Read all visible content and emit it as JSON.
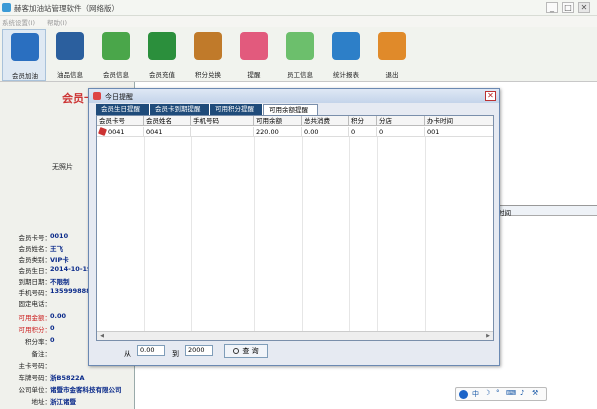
{
  "window": {
    "title": "赫客加油站管理软件（网络版）",
    "minimize": "_",
    "maximize": "□",
    "close": "✕"
  },
  "menu": [
    "系统设置(I)",
    "帮助(I)"
  ],
  "toolbar": [
    {
      "label": "会员加油",
      "icon": "member-fuel-icon",
      "color": "#2a6fc0"
    },
    {
      "label": "油品信息",
      "icon": "oil-info-icon",
      "color": "#2b5f9e"
    },
    {
      "label": "会员信息",
      "icon": "member-info-icon",
      "color": "#4aa64a"
    },
    {
      "label": "会员充值",
      "icon": "recharge-icon",
      "color": "#2b8f3c"
    },
    {
      "label": "积分兑换",
      "icon": "points-exchange-icon",
      "color": "#c07a2a"
    },
    {
      "label": "提醒",
      "icon": "reminder-icon",
      "color": "#e25a7d"
    },
    {
      "label": "员工信息",
      "icon": "staff-icon",
      "color": "#6cbf6c"
    },
    {
      "label": "统计报表",
      "icon": "report-icon",
      "color": "#2d7fc8"
    },
    {
      "label": "退出",
      "icon": "exit-icon",
      "color": "#e08a2a"
    }
  ],
  "left": {
    "title": "会员卡",
    "nophoto": "无照片",
    "rows": [
      {
        "k": "会员卡号：",
        "v": "0010"
      },
      {
        "k": "会员姓名：",
        "v": "王飞"
      },
      {
        "k": "会员类别：",
        "v": "VIP卡"
      },
      {
        "k": "会员生日：",
        "v": "2014-10-19"
      },
      {
        "k": "到期日期：",
        "v": "不限制"
      },
      {
        "k": "手机号码：",
        "v": "13599988822"
      },
      {
        "k": "固定电话：",
        "v": ""
      },
      {
        "k": "可用金额：",
        "v": "0.00",
        "red": true
      },
      {
        "k": "可用积分：",
        "v": "0",
        "red": true
      },
      {
        "k": "积分率：",
        "v": "0"
      },
      {
        "k": "备注：",
        "v": ""
      },
      {
        "k": "主卡号码：",
        "v": ""
      },
      {
        "k": "车牌号码：",
        "v": "浙B5822A"
      },
      {
        "k": "公司单位：",
        "v": "诸暨市金客科技有限公司"
      },
      {
        "k": "地址：",
        "v": "浙江诸暨"
      }
    ]
  },
  "bg_grid": {
    "header": "时间"
  },
  "dialog": {
    "title": "今日提醒",
    "close": "✕",
    "tabs": [
      "会员生日提醒",
      "会员卡到期提醒",
      "可用积分提醒",
      "可用余额提醒"
    ],
    "columns": [
      "会员卡号",
      "会员姓名",
      "手机号码",
      "可用余额",
      "总共消费",
      "积分",
      "分店",
      "办卡时间"
    ],
    "rows": [
      [
        "0041",
        "0041",
        "",
        "220.00",
        "0.00",
        "0",
        "0",
        "001"
      ]
    ],
    "filter": {
      "from_label": "从",
      "from": "0.00",
      "to_label": "到",
      "to": "2000",
      "query": "查 询"
    }
  },
  "ime": {
    "items": [
      "中",
      "☽",
      "°",
      "⌨",
      "♪",
      "⚒"
    ]
  }
}
